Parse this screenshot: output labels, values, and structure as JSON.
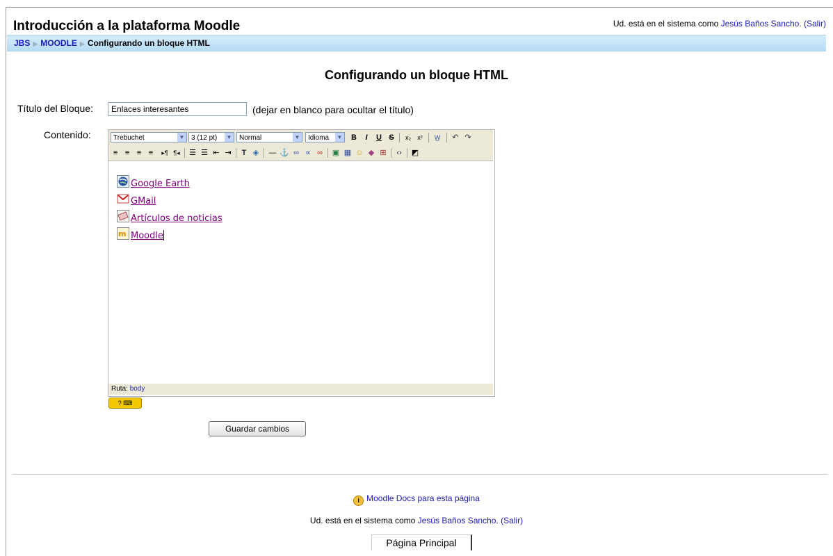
{
  "header": {
    "site_title": "Introducción a la plataforma Moodle",
    "login_prefix": "Ud. está en el sistema como ",
    "user_name": "Jesús Baños Sancho.",
    "logout": "(Salir)"
  },
  "breadcrumb": [
    "JBS",
    "MOODLE",
    "Configurando un bloque HTML"
  ],
  "page_heading": "Configurando un bloque HTML",
  "form": {
    "title_label": "Título del Bloque:",
    "title_value": "Enlaces interesantes",
    "title_hint": "(dejar en blanco para ocultar el título)",
    "content_label": "Contenido:",
    "save_button": "Guardar cambios"
  },
  "editor": {
    "font_select": "Trebuchet",
    "size_select": "3 (12 pt)",
    "format_select": "Normal",
    "lang_select": "Idioma",
    "links": [
      {
        "text": "Google Earth",
        "icon": "google-earth-icon"
      },
      {
        "text": "GMail",
        "icon": "gmail-icon"
      },
      {
        "text": "Artículos de noticias",
        "icon": "news-icon"
      },
      {
        "text": "Moodle",
        "icon": "moodle-icon"
      }
    ],
    "path_label": "Ruta:",
    "path_value": "body"
  },
  "footer": {
    "docs_link": "Moodle Docs para esta página",
    "login_prefix": "Ud. está en el sistema como ",
    "user_name": "Jesús Baños Sancho.",
    "logout": "(Salir)",
    "home": "Página Principal"
  }
}
